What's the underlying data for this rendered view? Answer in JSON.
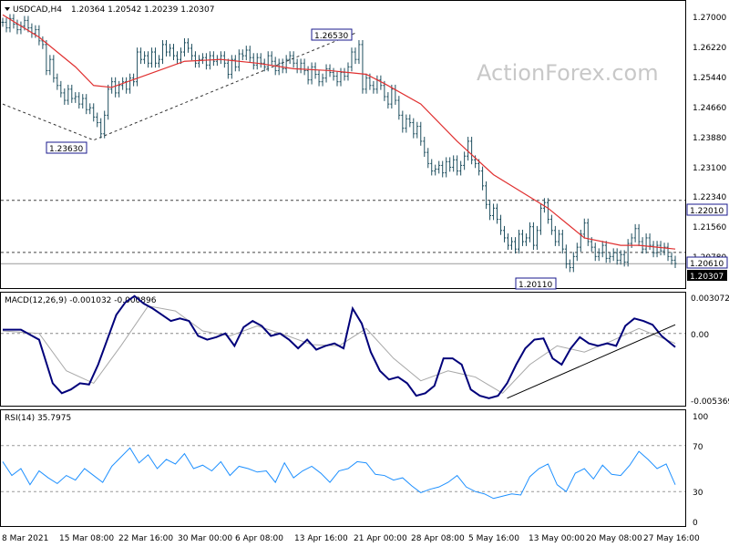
{
  "header": {
    "symbol": "USDCAD,H4",
    "ohlc": "1.20364 1.20542 1.20239 1.20307",
    "watermark": "ActionForex.com"
  },
  "colors": {
    "price_bars": "#1f4f5f",
    "ma_line": "#e03030",
    "macd_line": "#00007a",
    "macd_signal": "#a8a8a8",
    "rsi_line": "#1e90ff",
    "label_box": "#1a1a8c",
    "grid_dashed": "#444444"
  },
  "chart_data": [
    {
      "type": "line",
      "panel": "price",
      "title": "USDCAD,H4",
      "ylim": [
        1.1965,
        1.2735
      ],
      "y_ticks": [
        "1.27000",
        "1.26220",
        "1.25440",
        "1.24660",
        "1.23880",
        "1.23100",
        "1.22340",
        "1.21560",
        "1.20780"
      ],
      "x_ticks": [
        "8 Mar 2021",
        "15 Mar 08:00",
        "22 Mar 16:00",
        "30 Mar 00:00",
        "6 Apr 08:00",
        "13 Apr 16:00",
        "21 Apr 00:00",
        "28 Apr 08:00",
        "5 May 16:00",
        "13 May 00:00",
        "20 May 08:00",
        "27 May 16:00"
      ],
      "series": [
        {
          "name": "Close",
          "x": [
            0,
            4,
            8,
            12,
            16,
            20,
            24,
            28,
            32,
            36,
            40,
            44,
            48,
            52,
            56,
            60,
            64,
            68,
            72,
            76,
            80,
            84,
            88,
            92,
            96,
            100,
            104,
            108,
            112,
            116,
            120,
            124,
            128,
            132,
            136,
            140,
            144,
            148,
            152,
            156,
            160,
            164,
            168,
            172,
            176,
            180,
            184,
            188,
            192,
            196,
            200,
            204,
            208,
            212,
            216,
            220,
            224,
            228,
            232,
            236,
            240,
            244,
            248,
            252,
            256,
            260,
            264,
            268,
            272,
            276,
            280,
            284,
            288,
            292,
            296,
            300,
            304,
            308,
            312,
            316,
            320,
            324,
            328,
            332,
            336,
            340,
            344,
            348,
            352,
            356,
            360,
            364,
            368,
            372,
            376,
            380,
            384,
            388,
            392,
            396,
            400,
            404,
            408,
            412,
            416,
            420,
            424,
            428,
            432,
            436,
            440,
            444,
            448,
            452,
            456,
            460,
            464,
            468,
            472,
            476,
            480,
            484,
            488,
            492,
            496,
            500,
            504,
            508,
            512,
            516,
            520,
            524,
            528,
            532,
            536,
            540,
            544,
            548,
            552,
            556,
            560,
            564,
            568,
            572,
            576,
            580,
            584,
            588,
            592,
            596,
            600,
            604,
            608,
            612,
            616,
            620,
            624,
            628,
            632,
            636,
            640,
            644,
            648,
            652,
            656,
            660,
            664,
            668,
            672,
            676,
            680,
            684,
            688,
            692,
            696,
            700,
            704,
            708,
            712,
            716,
            720,
            724,
            728,
            732,
            736,
            740
          ],
          "values": [
            1.268,
            1.2665,
            1.269,
            1.2675,
            1.266,
            1.267,
            1.2685,
            1.2665,
            1.265,
            1.266,
            1.263,
            1.262,
            1.255,
            1.258,
            1.253,
            1.251,
            1.249,
            1.247,
            1.25,
            1.2475,
            1.248,
            1.246,
            1.2475,
            1.2445,
            1.245,
            1.2425,
            1.241,
            1.238,
            1.243,
            1.25,
            1.252,
            1.249,
            1.251,
            1.252,
            1.25,
            1.253,
            1.252,
            1.26,
            1.258,
            1.259,
            1.257,
            1.26,
            1.257,
            1.258,
            1.262,
            1.26,
            1.261,
            1.259,
            1.258,
            1.26,
            1.2625,
            1.261,
            1.259,
            1.257,
            1.258,
            1.2585,
            1.2565,
            1.259,
            1.2575,
            1.258,
            1.259,
            1.257,
            1.254,
            1.258,
            1.256,
            1.2595,
            1.259,
            1.2605,
            1.2585,
            1.2565,
            1.2585,
            1.257,
            1.256,
            1.259,
            1.2575,
            1.255,
            1.257,
            1.2555,
            1.258,
            1.259,
            1.257,
            1.2555,
            1.257,
            1.255,
            1.2525,
            1.256,
            1.254,
            1.252,
            1.253,
            1.2555,
            1.2545,
            1.2535,
            1.252,
            1.2545,
            1.2535,
            1.256,
            1.26,
            1.258,
            1.262,
            1.25,
            1.253,
            1.251,
            1.25,
            1.2525,
            1.251,
            1.248,
            1.246,
            1.25,
            1.247,
            1.243,
            1.2395,
            1.242,
            1.241,
            1.238,
            1.24,
            1.236,
            1.233,
            1.23,
            1.228,
            1.2285,
            1.2295,
            1.2275,
            1.2305,
            1.229,
            1.231,
            1.228,
            1.2295,
            1.232,
            1.236,
            1.231,
            1.23,
            1.228,
            1.224,
            1.219,
            1.216,
            1.218,
            1.215,
            1.212,
            1.21,
            1.208,
            1.209,
            1.207,
            1.211,
            1.209,
            1.21,
            1.213,
            1.208,
            1.212,
            1.218,
            1.2195,
            1.215,
            1.212,
            1.209,
            1.211,
            1.207,
            1.203,
            1.202,
            1.205,
            1.2075,
            1.211,
            1.214,
            1.209,
            1.2075,
            1.205,
            1.206,
            1.208,
            1.2045,
            1.205,
            1.206,
            1.204,
            1.2055,
            1.2035,
            1.2085,
            1.21,
            1.2125,
            1.209,
            1.207,
            1.21,
            1.208,
            1.206,
            1.208,
            1.2065,
            1.2075,
            1.205,
            1.204,
            1.2031
          ]
        },
        {
          "name": "MA",
          "x": [
            0,
            40,
            80,
            100,
            120,
            160,
            200,
            240,
            280,
            320,
            360,
            400,
            420,
            460,
            500,
            540,
            580,
            600,
            620,
            640,
            680,
            700,
            720,
            740
          ],
          "values": [
            1.27,
            1.264,
            1.256,
            1.251,
            1.2505,
            1.254,
            1.2575,
            1.258,
            1.257,
            1.2555,
            1.255,
            1.254,
            1.2515,
            1.246,
            1.236,
            1.227,
            1.221,
            1.218,
            1.214,
            1.21,
            1.208,
            1.208,
            1.2075,
            1.207
          ]
        }
      ],
      "annotations": {
        "swing_high": "1.26530",
        "swing_low": "1.23630",
        "recent_low": "1.20110",
        "level_upper": "1.22010",
        "level_lower": "1.20610",
        "last_price": "1.20307"
      }
    },
    {
      "type": "line",
      "panel": "macd",
      "title": "MACD(12,26,9) -0.001032 -0.000896",
      "ylim": [
        -0.0058,
        0.0032
      ],
      "y_ticks": [
        "0.003072",
        "0.00",
        "-0.005369"
      ],
      "series": [
        {
          "name": "MACD",
          "x": [
            0,
            20,
            40,
            55,
            65,
            75,
            85,
            95,
            105,
            115,
            125,
            135,
            145,
            155,
            165,
            175,
            185,
            195,
            205,
            215,
            225,
            235,
            245,
            255,
            265,
            275,
            285,
            295,
            305,
            315,
            325,
            335,
            345,
            355,
            365,
            375,
            385,
            395,
            405,
            415,
            425,
            435,
            445,
            455,
            465,
            475,
            485,
            495,
            505,
            515,
            525,
            535,
            545,
            555,
            565,
            575,
            585,
            595,
            605,
            615,
            625,
            635,
            645,
            655,
            665,
            675,
            685,
            695,
            705,
            715,
            725,
            740
          ],
          "values": [
            0.0003,
            0.0003,
            -0.0005,
            -0.004,
            -0.0048,
            -0.0045,
            -0.004,
            -0.0041,
            -0.0025,
            -0.0005,
            0.0015,
            0.0025,
            0.003,
            0.0024,
            0.002,
            0.0015,
            0.001,
            0.0012,
            0.001,
            -0.0002,
            -0.0005,
            -0.0003,
            0.0,
            -0.001,
            0.0005,
            0.001,
            0.0006,
            -0.0002,
            0.0,
            -0.0005,
            -0.0012,
            -0.0005,
            -0.0013,
            -0.001,
            -0.0008,
            -0.0012,
            0.002,
            0.0008,
            -0.0015,
            -0.003,
            -0.0037,
            -0.0035,
            -0.004,
            -0.005,
            -0.0048,
            -0.0042,
            -0.002,
            -0.002,
            -0.0025,
            -0.0045,
            -0.005,
            -0.0052,
            -0.005,
            -0.004,
            -0.0025,
            -0.0012,
            -0.0005,
            -0.0004,
            -0.002,
            -0.0025,
            -0.0012,
            -0.0003,
            -0.0008,
            -0.001,
            -0.0008,
            -0.001,
            0.0006,
            0.0012,
            0.001,
            0.0007,
            -0.0002,
            -0.0011
          ]
        },
        {
          "name": "Signal",
          "x": [
            0,
            40,
            70,
            100,
            130,
            160,
            190,
            220,
            250,
            280,
            310,
            340,
            370,
            400,
            430,
            460,
            490,
            520,
            550,
            580,
            610,
            640,
            670,
            700,
            740
          ],
          "values": [
            0.0002,
            0.0,
            -0.003,
            -0.004,
            -0.001,
            0.0022,
            0.0018,
            0.0002,
            -0.0002,
            0.0006,
            -0.0001,
            -0.0009,
            -0.001,
            0.0004,
            -0.002,
            -0.0038,
            -0.003,
            -0.0035,
            -0.0048,
            -0.0025,
            -0.001,
            -0.0015,
            -0.0006,
            0.0004,
            -0.0008
          ]
        }
      ]
    },
    {
      "type": "line",
      "panel": "rsi",
      "title": "RSI(14) 35.7975",
      "ylim": [
        0,
        100
      ],
      "y_ticks": [
        "100",
        "70",
        "30",
        "0"
      ],
      "series": [
        {
          "name": "RSI",
          "x": [
            0,
            10,
            20,
            30,
            40,
            50,
            60,
            70,
            80,
            90,
            100,
            110,
            120,
            130,
            140,
            150,
            160,
            170,
            180,
            190,
            200,
            210,
            220,
            230,
            240,
            250,
            260,
            270,
            280,
            290,
            300,
            310,
            320,
            330,
            340,
            350,
            360,
            370,
            380,
            390,
            400,
            410,
            420,
            430,
            440,
            450,
            460,
            470,
            480,
            490,
            500,
            510,
            520,
            530,
            540,
            550,
            560,
            570,
            580,
            590,
            600,
            610,
            620,
            630,
            640,
            650,
            660,
            670,
            680,
            690,
            700,
            710,
            720,
            730,
            740
          ],
          "values": [
            56,
            44,
            50,
            36,
            48,
            42,
            37,
            44,
            40,
            50,
            44,
            38,
            52,
            60,
            68,
            55,
            62,
            50,
            58,
            54,
            63,
            50,
            53,
            48,
            56,
            44,
            52,
            50,
            47,
            48,
            38,
            55,
            42,
            48,
            52,
            46,
            38,
            48,
            50,
            56,
            55,
            45,
            44,
            40,
            42,
            35,
            29,
            32,
            34,
            38,
            44,
            34,
            30,
            28,
            24,
            26,
            28,
            27,
            43,
            50,
            54,
            36,
            30,
            46,
            50,
            41,
            53,
            45,
            44,
            53,
            65,
            58,
            50,
            54,
            36
          ]
        }
      ]
    }
  ]
}
